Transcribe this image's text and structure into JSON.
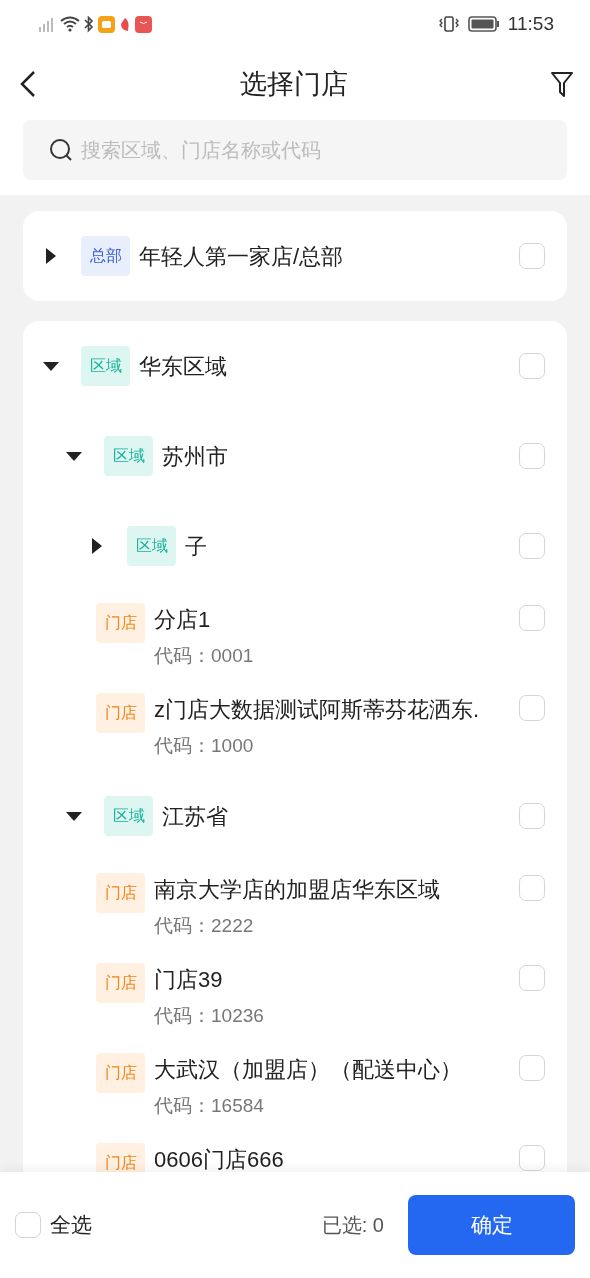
{
  "status_bar": {
    "time": "11:53"
  },
  "header": {
    "title": "选择门店"
  },
  "search": {
    "placeholder": "搜索区域、门店名称或代码"
  },
  "tree": [
    {
      "kind": "hq",
      "tag": "总部",
      "name": "年轻人第一家店/总部",
      "expanded": false,
      "checked": false
    },
    {
      "kind": "region",
      "tag": "区域",
      "name": "华东区域",
      "expanded": true,
      "checked": false,
      "children": [
        {
          "kind": "region",
          "tag": "区域",
          "name": "苏州市",
          "expanded": true,
          "checked": false,
          "children": [
            {
              "kind": "region",
              "tag": "区域",
              "name": "子",
              "expanded": false,
              "checked": false
            },
            {
              "kind": "store",
              "tag": "门店",
              "name": "分店1",
              "code": "代码：0001",
              "checked": false
            },
            {
              "kind": "store",
              "tag": "门店",
              "name": "z门店大数据测试阿斯蒂芬花洒东.",
              "code": "代码：1000",
              "checked": false
            }
          ]
        },
        {
          "kind": "region",
          "tag": "区域",
          "name": "江苏省",
          "expanded": true,
          "checked": false,
          "children": [
            {
              "kind": "store",
              "tag": "门店",
              "name": "南京大学店的加盟店华东区域",
              "code": "代码：2222",
              "checked": false
            },
            {
              "kind": "store",
              "tag": "门店",
              "name": "门店39",
              "code": "代码：10236",
              "checked": false
            },
            {
              "kind": "store",
              "tag": "门店",
              "name": "大武汉（加盟店）（配送中心）",
              "code": "代码：16584",
              "checked": false
            },
            {
              "kind": "store",
              "tag": "门店",
              "name": "0606门店666",
              "checked": false
            }
          ]
        }
      ]
    }
  ],
  "footer": {
    "select_all": {
      "label": "全选",
      "checked": false
    },
    "selected_count": "已选: 0",
    "confirm": "确定"
  }
}
